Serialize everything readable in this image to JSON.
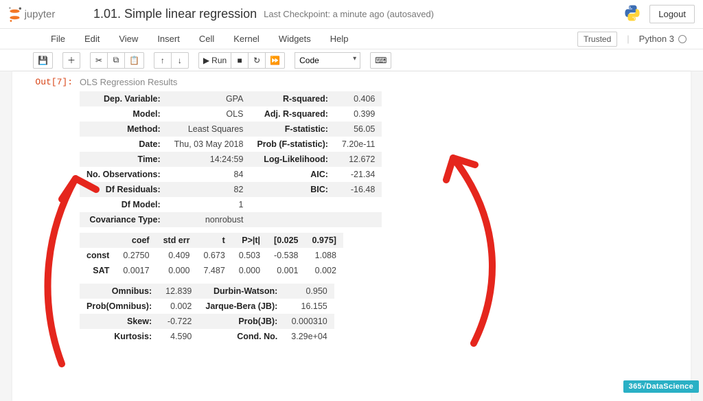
{
  "header": {
    "brand": "jupyter",
    "notebook_title": "1.01. Simple linear regression",
    "checkpoint": "Last Checkpoint: a minute ago  (autosaved)",
    "logout": "Logout"
  },
  "menubar": {
    "items": [
      "File",
      "Edit",
      "View",
      "Insert",
      "Cell",
      "Kernel",
      "Widgets",
      "Help"
    ],
    "trusted": "Trusted",
    "kernel": "Python 3"
  },
  "toolbar": {
    "run_label": "Run",
    "celltype": "Code"
  },
  "cell": {
    "prompt": "Out[7]:",
    "ols_title": "OLS Regression Results",
    "summary1_left": [
      {
        "label": "Dep. Variable:",
        "value": "GPA"
      },
      {
        "label": "Model:",
        "value": "OLS"
      },
      {
        "label": "Method:",
        "value": "Least Squares"
      },
      {
        "label": "Date:",
        "value": "Thu, 03 May 2018"
      },
      {
        "label": "Time:",
        "value": "14:24:59"
      },
      {
        "label": "No. Observations:",
        "value": "84"
      },
      {
        "label": "Df Residuals:",
        "value": "82"
      },
      {
        "label": "Df Model:",
        "value": "1"
      },
      {
        "label": "Covariance Type:",
        "value": "nonrobust"
      }
    ],
    "summary1_right": [
      {
        "label": "R-squared:",
        "value": "0.406"
      },
      {
        "label": "Adj. R-squared:",
        "value": "0.399"
      },
      {
        "label": "F-statistic:",
        "value": "56.05"
      },
      {
        "label": "Prob (F-statistic):",
        "value": "7.20e-11"
      },
      {
        "label": "Log-Likelihood:",
        "value": "12.672"
      },
      {
        "label": "AIC:",
        "value": "-21.34"
      },
      {
        "label": "BIC:",
        "value": "-16.48"
      }
    ],
    "coef_headers": [
      "",
      "coef",
      "std err",
      "t",
      "P>|t|",
      "[0.025",
      "0.975]"
    ],
    "coef_rows": [
      {
        "name": "const",
        "vals": [
          "0.2750",
          "0.409",
          "0.673",
          "0.503",
          "-0.538",
          "1.088"
        ]
      },
      {
        "name": "SAT",
        "vals": [
          "0.0017",
          "0.000",
          "7.487",
          "0.000",
          "0.001",
          "0.002"
        ]
      }
    ],
    "diag_left": [
      {
        "label": "Omnibus:",
        "value": "12.839"
      },
      {
        "label": "Prob(Omnibus):",
        "value": "0.002"
      },
      {
        "label": "Skew:",
        "value": "-0.722"
      },
      {
        "label": "Kurtosis:",
        "value": "4.590"
      }
    ],
    "diag_right": [
      {
        "label": "Durbin-Watson:",
        "value": "0.950"
      },
      {
        "label": "Jarque-Bera (JB):",
        "value": "16.155"
      },
      {
        "label": "Prob(JB):",
        "value": "0.000310"
      },
      {
        "label": "Cond. No.",
        "value": "3.29e+04"
      }
    ]
  },
  "badge": "365√DataScience"
}
